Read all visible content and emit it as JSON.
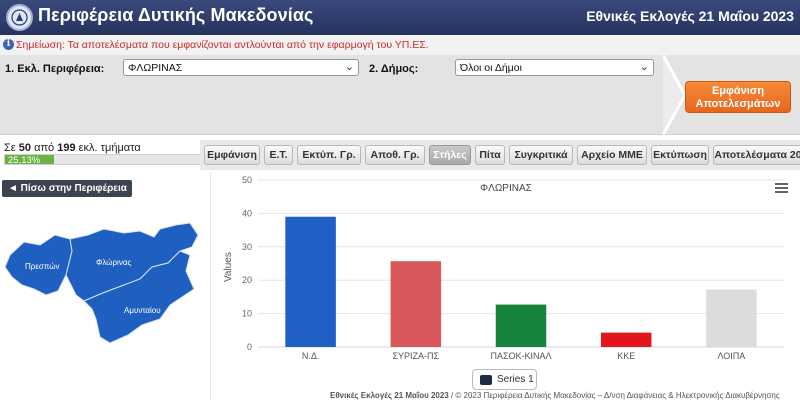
{
  "header": {
    "title": "Περιφέρεια Δυτικής Μακεδονίας",
    "election": "Εθνικές Εκλογές 21 Μαΐου 2023"
  },
  "notice": {
    "text": "Σημείωση: Τα αποτελέσματα που εμφανίζονται αντλούνται από την εφαρμογή του ΥΠ.ΕΣ."
  },
  "filters": {
    "region_label": "1. Εκλ. Περιφέρεια:",
    "region_value": "ΦΛΩΡΙΝΑΣ",
    "municipality_label": "2. Δήμος:",
    "municipality_value": "Όλοι οι Δήμοι",
    "show_button_line1": "Εμφάνιση",
    "show_button_line2": "Αποτελεσμάτων"
  },
  "progress": {
    "prefix": "Σε",
    "counted": "50",
    "middle": "από",
    "total": "199",
    "suffix": "εκλ. τμήματα",
    "percent_label": "25,13%",
    "fraction": 0.2513
  },
  "tabs": [
    {
      "label": "Εμφάνιση"
    },
    {
      "label": "Ε.Τ."
    },
    {
      "label": "Εκτύπ. Γρ."
    },
    {
      "label": "Αποθ. Γρ."
    },
    {
      "label": "Στήλες",
      "active": true
    },
    {
      "label": "Πίτα"
    },
    {
      "label": "Συγκριτικά"
    },
    {
      "label": "Αρχείο ΜΜΕ"
    },
    {
      "label": "Εκτύπωση"
    },
    {
      "label": "Αποτελέσματα 20"
    }
  ],
  "back_button": "◄ Πίσω στην Περιφέρεια",
  "map": {
    "labels": [
      "Πρεσπών",
      "Φλώρινας",
      "Αμυνταίου"
    ],
    "fill": "#1f5fbf"
  },
  "chart_data": {
    "type": "bar",
    "title": "ΦΛΩΡΙΝΑΣ",
    "ylabel": "Values",
    "xlabel": "",
    "ylim": [
      0,
      50
    ],
    "yticks": [
      0,
      10,
      20,
      30,
      40,
      50
    ],
    "categories": [
      "Ν.Δ.",
      "ΣΥΡΙΖΑ-ΠΣ",
      "ΠΑΣΟΚ-ΚΙΝΑΛ",
      "ΚΚΕ",
      "ΛΟΙΠΑ"
    ],
    "colors": [
      "#1f5fc6",
      "#d9585c",
      "#17843d",
      "#e0161b",
      "#dcdcdc"
    ],
    "series": [
      {
        "name": "Series 1",
        "values": [
          39,
          25.7,
          12.7,
          4.3,
          17.2
        ]
      }
    ],
    "grid": true,
    "legend": "bottom-center"
  },
  "footer": {
    "bold": "Εθνικές Εκλογές 21 Μαΐου 2023",
    "rest": " / © 2023 Περιφέρεια Δυτικής Μακεδονίας – Δ/νση Διαφάνειας & Ηλεκτρονικής Διακυβέρνησης"
  }
}
